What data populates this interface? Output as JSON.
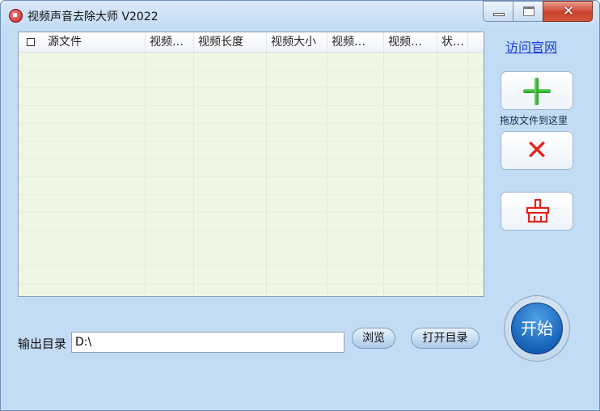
{
  "window": {
    "title": "视频声音去除大师 V2022",
    "close_glyph": "✕"
  },
  "list": {
    "columns": [
      "源文件",
      "视频…",
      "视频长度",
      "视频大小",
      "视频…",
      "视频…",
      "状…"
    ]
  },
  "side": {
    "website_link": "访问官网",
    "drop_label": "拖放文件到这里",
    "add_icon": "plus-icon",
    "remove_icon": "x-icon",
    "clear_icon": "broom-icon",
    "start_label": "开始"
  },
  "output": {
    "label": "输出目录",
    "value": "D:\\",
    "browse_label": "浏览",
    "open_label": "打开目录"
  },
  "colors": {
    "window_bg": "#c3dcf5",
    "list_bg": "#eef7e4",
    "link": "#1a3fd0",
    "add_green": "#1d9a1a",
    "remove_red": "#e2231a",
    "start_blue": "#1762b8"
  }
}
